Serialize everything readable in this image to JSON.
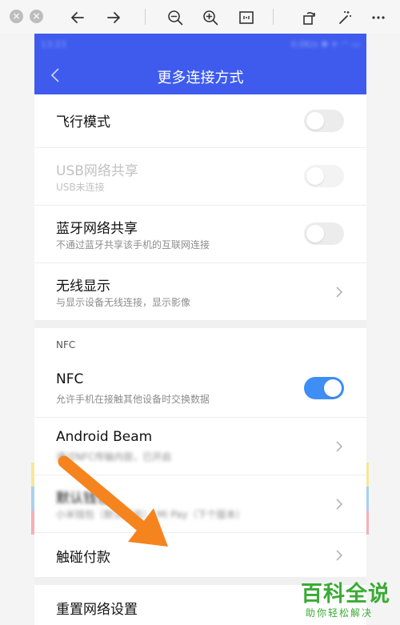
{
  "phone": {
    "status_time": "13:23",
    "status_right": "0.0K/s ✱ ✈ ◠ ▭",
    "header_title": "更多连接方式",
    "accent_color": "#3e5bee"
  },
  "settings": {
    "airplane_title": "飞行模式",
    "usb_title": "USB网络共享",
    "usb_sub": "USB未连接",
    "bt_title": "蓝牙网络共享",
    "bt_sub": "不通过蓝牙共享该手机的互联网连接",
    "wireless_title": "无线显示",
    "wireless_sub": "与显示设备无线连接，显示影像",
    "nfc_section": "NFC",
    "nfc_title": "NFC",
    "nfc_sub": "允许手机在接触其他设备时交换数据",
    "beam_title": "Android Beam",
    "beam_sub": "通过NFC传输内容，已开启",
    "default_wallet_title": "默认钱包",
    "default_wallet_sub": "小米钱包（默认开启），Mi Pay（下个版本）",
    "tap_pay_title": "触碰付款",
    "reset_title": "重置网络设置"
  },
  "toggles": {
    "airplane_on": false,
    "usb_on": false,
    "bt_on": false,
    "nfc_on": true
  },
  "watermark": {
    "main": "百科全说",
    "sub": "助你轻松解决"
  },
  "icons": [
    "close-icon",
    "back-arrow-icon",
    "forward-arrow-icon",
    "zoom-out-icon",
    "zoom-in-icon",
    "fit-icon",
    "rotate-icon",
    "magic-wand-icon",
    "more-icon",
    "chevron-right-icon"
  ]
}
